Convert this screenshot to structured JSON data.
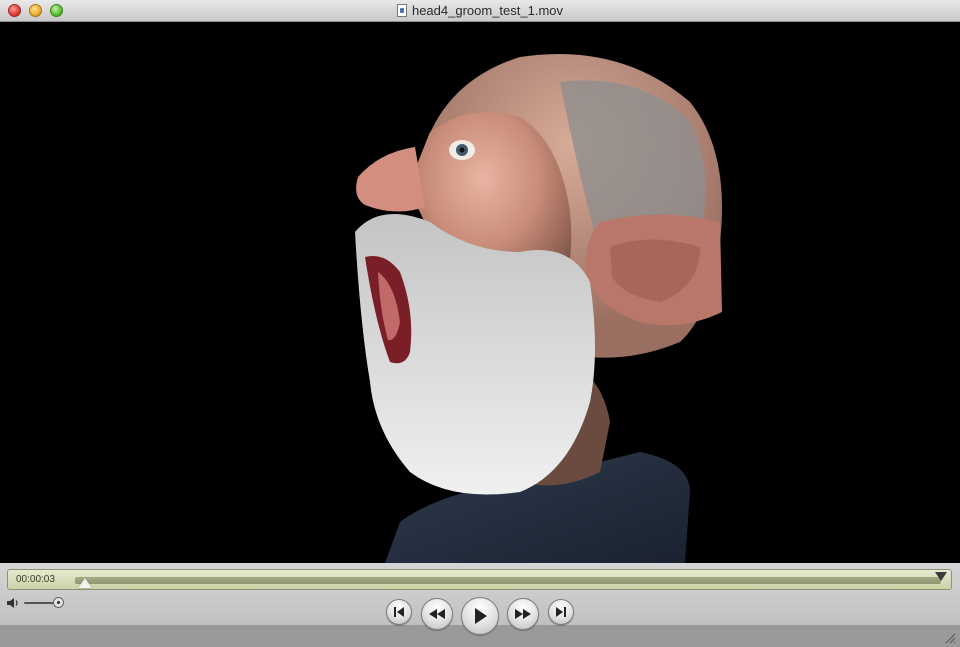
{
  "window": {
    "title": "head4_groom_test_1.mov"
  },
  "controller": {
    "timecode": "00:00:03",
    "playback_progress_fraction": 0.01,
    "volume_fraction": 0.85
  },
  "icons": {
    "document": "quicktime-document-icon",
    "volume": "speaker-icon",
    "prev": "go-to-start-icon",
    "rewind": "rewind-icon",
    "play": "play-icon",
    "ffwd": "fast-forward-icon",
    "next": "go-to-end-icon",
    "resize": "resize-grip-icon"
  },
  "colors": {
    "video_background": "#000000",
    "scrubber_lcd": "#dde0bf",
    "window_chrome": "#c8c8c8"
  }
}
